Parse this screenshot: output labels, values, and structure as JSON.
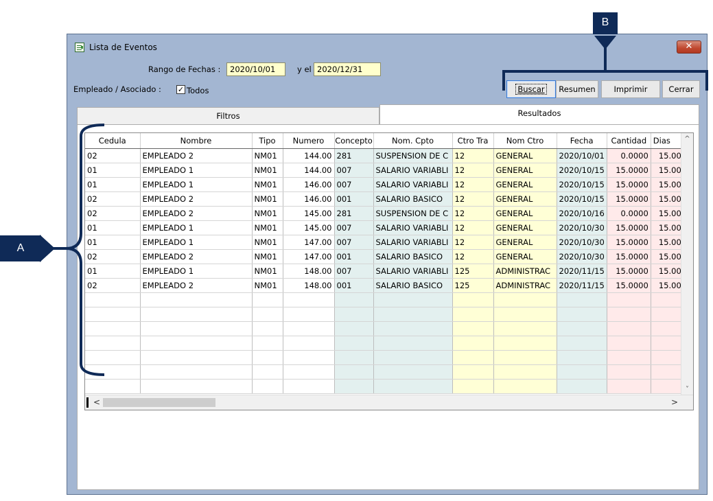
{
  "window": {
    "title": "Lista de Eventos",
    "close_symbol": "✕"
  },
  "filters": {
    "date_range_label": "Rango de Fechas :",
    "date_from": "2020/10/01",
    "and_label": "y el",
    "date_to": "2020/12/31",
    "employee_label": "Empleado / Asociado :",
    "todos_checked_symbol": "✓",
    "todos_label": "Todos"
  },
  "buttons": {
    "buscar": "Buscar",
    "resumen": "Resumen",
    "imprimir": "Imprimir",
    "cerrar": "Cerrar"
  },
  "tabs": {
    "filtros": "Filtros",
    "resultados": "Resultados"
  },
  "table": {
    "columns": [
      "Cedula",
      "Nombre",
      "Tipo",
      "Numero",
      "Concepto",
      "Nom. Cpto",
      "Ctro Tra",
      "Nom Ctro",
      "Fecha",
      "Cantidad",
      "Dias"
    ],
    "rows": [
      [
        "02",
        "EMPLEADO 2",
        "NM01",
        "144.00",
        "281",
        "SUSPENSION DE C",
        "12",
        "GENERAL",
        "2020/10/01",
        "0.0000",
        "15.00"
      ],
      [
        "01",
        "EMPLEADO 1",
        "NM01",
        "144.00",
        "007",
        "SALARIO VARIABLI",
        "12",
        "GENERAL",
        "2020/10/15",
        "15.0000",
        "15.00"
      ],
      [
        "01",
        "EMPLEADO 1",
        "NM01",
        "146.00",
        "007",
        "SALARIO VARIABLI",
        "12",
        "GENERAL",
        "2020/10/15",
        "15.0000",
        "15.00"
      ],
      [
        "02",
        "EMPLEADO 2",
        "NM01",
        "146.00",
        "001",
        "SALARIO BASICO",
        "12",
        "GENERAL",
        "2020/10/15",
        "15.0000",
        "15.00"
      ],
      [
        "02",
        "EMPLEADO 2",
        "NM01",
        "145.00",
        "281",
        "SUSPENSION DE C",
        "12",
        "GENERAL",
        "2020/10/16",
        "0.0000",
        "15.00"
      ],
      [
        "01",
        "EMPLEADO 1",
        "NM01",
        "145.00",
        "007",
        "SALARIO VARIABLI",
        "12",
        "GENERAL",
        "2020/10/30",
        "15.0000",
        "15.00"
      ],
      [
        "01",
        "EMPLEADO 1",
        "NM01",
        "147.00",
        "007",
        "SALARIO VARIABLI",
        "12",
        "GENERAL",
        "2020/10/30",
        "15.0000",
        "15.00"
      ],
      [
        "02",
        "EMPLEADO 2",
        "NM01",
        "147.00",
        "001",
        "SALARIO BASICO",
        "12",
        "GENERAL",
        "2020/10/30",
        "15.0000",
        "15.00"
      ],
      [
        "01",
        "EMPLEADO 1",
        "NM01",
        "148.00",
        "007",
        "SALARIO VARIABLI",
        "125",
        "ADMINISTRAC",
        "2020/11/15",
        "15.0000",
        "15.00"
      ],
      [
        "02",
        "EMPLEADO 2",
        "NM01",
        "148.00",
        "001",
        "SALARIO BASICO",
        "125",
        "ADMINISTRAC",
        "2020/11/15",
        "15.0000",
        "15.00"
      ]
    ],
    "empty_row_count": 7
  },
  "scroll": {
    "up": "^",
    "down": "˅",
    "left": "<",
    "right": ">"
  },
  "callouts": {
    "a": "A",
    "b": "B"
  },
  "colors": {
    "annotation": "#0f2a57",
    "window_bg": "#a3b6d2",
    "input_bg": "#ffffcc",
    "col_teal": "#e3f0ef",
    "col_yellow": "#ffffd6",
    "col_pink": "#ffeaea"
  }
}
